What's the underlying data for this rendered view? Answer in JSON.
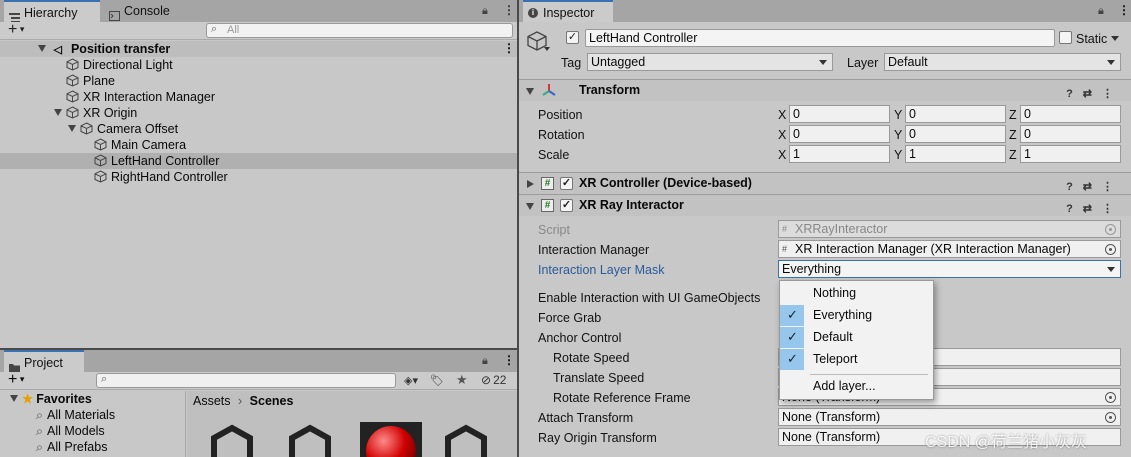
{
  "hierarchy": {
    "tab_label": "Hierarchy",
    "console_tab_label": "Console",
    "add_label": "+",
    "search_placeholder": "All",
    "scene_name": "Position transfer",
    "items": [
      {
        "label": "Directional Light"
      },
      {
        "label": "Plane"
      },
      {
        "label": "XR Interaction Manager"
      },
      {
        "label": "XR Origin"
      },
      {
        "label": "Camera Offset"
      },
      {
        "label": "Main Camera"
      },
      {
        "label": "LeftHand Controller"
      },
      {
        "label": "RightHand Controller"
      }
    ]
  },
  "project": {
    "tab_label": "Project",
    "add_label": "+",
    "hidden_count": "22",
    "favorites_label": "Favorites",
    "favorites": [
      {
        "label": "All Materials"
      },
      {
        "label": "All Models"
      },
      {
        "label": "All Prefabs"
      }
    ],
    "breadcrumb": {
      "root": "Assets",
      "current": "Scenes"
    }
  },
  "inspector": {
    "tab_label": "Inspector",
    "object_name": "LeftHand Controller",
    "static_label": "Static",
    "tag_label": "Tag",
    "tag_value": "Untagged",
    "layer_label": "Layer",
    "layer_value": "Default",
    "transform": {
      "title": "Transform",
      "rows": [
        {
          "label": "Position",
          "x": "0",
          "y": "0",
          "z": "0"
        },
        {
          "label": "Rotation",
          "x": "0",
          "y": "0",
          "z": "0"
        },
        {
          "label": "Scale",
          "x": "1",
          "y": "1",
          "z": "1"
        }
      ],
      "axis_x": "X",
      "axis_y": "Y",
      "axis_z": "Z"
    },
    "xr_controller": {
      "title": "XR Controller (Device-based)"
    },
    "xr_ray": {
      "title": "XR Ray Interactor",
      "script_label": "Script",
      "script_value": "XRRayInteractor",
      "interaction_manager_label": "Interaction Manager",
      "interaction_manager_value": "XR Interaction Manager (XR Interaction Manager)",
      "layer_mask_label": "Interaction Layer Mask",
      "layer_mask_value": "Everything",
      "enable_ui_label": "Enable Interaction with UI GameObjects",
      "force_grab_label": "Force Grab",
      "anchor_control_label": "Anchor Control",
      "rotate_speed_label": "Rotate Speed",
      "translate_speed_label": "Translate Speed",
      "rotate_ref_label": "Rotate Reference Frame",
      "rotate_ref_value": "None (Transform)",
      "attach_transform_label": "Attach Transform",
      "attach_transform_value": "None (Transform)",
      "ray_origin_label": "Ray Origin Transform",
      "ray_origin_value": "None (Transform)"
    },
    "dropdown": {
      "options": [
        {
          "label": "Nothing",
          "checked": false
        },
        {
          "label": "Everything",
          "checked": true
        },
        {
          "label": "Default",
          "checked": true
        },
        {
          "label": "Teleport",
          "checked": true
        }
      ],
      "add_layer_label": "Add layer..."
    }
  },
  "watermark": "CSDN @荷兰猪小灰灰",
  "colors": {
    "accent": "#3a72b0",
    "selection": "#b0b0b0",
    "check_bg": "#97c6ec",
    "link_label": "#2a5a9a"
  }
}
